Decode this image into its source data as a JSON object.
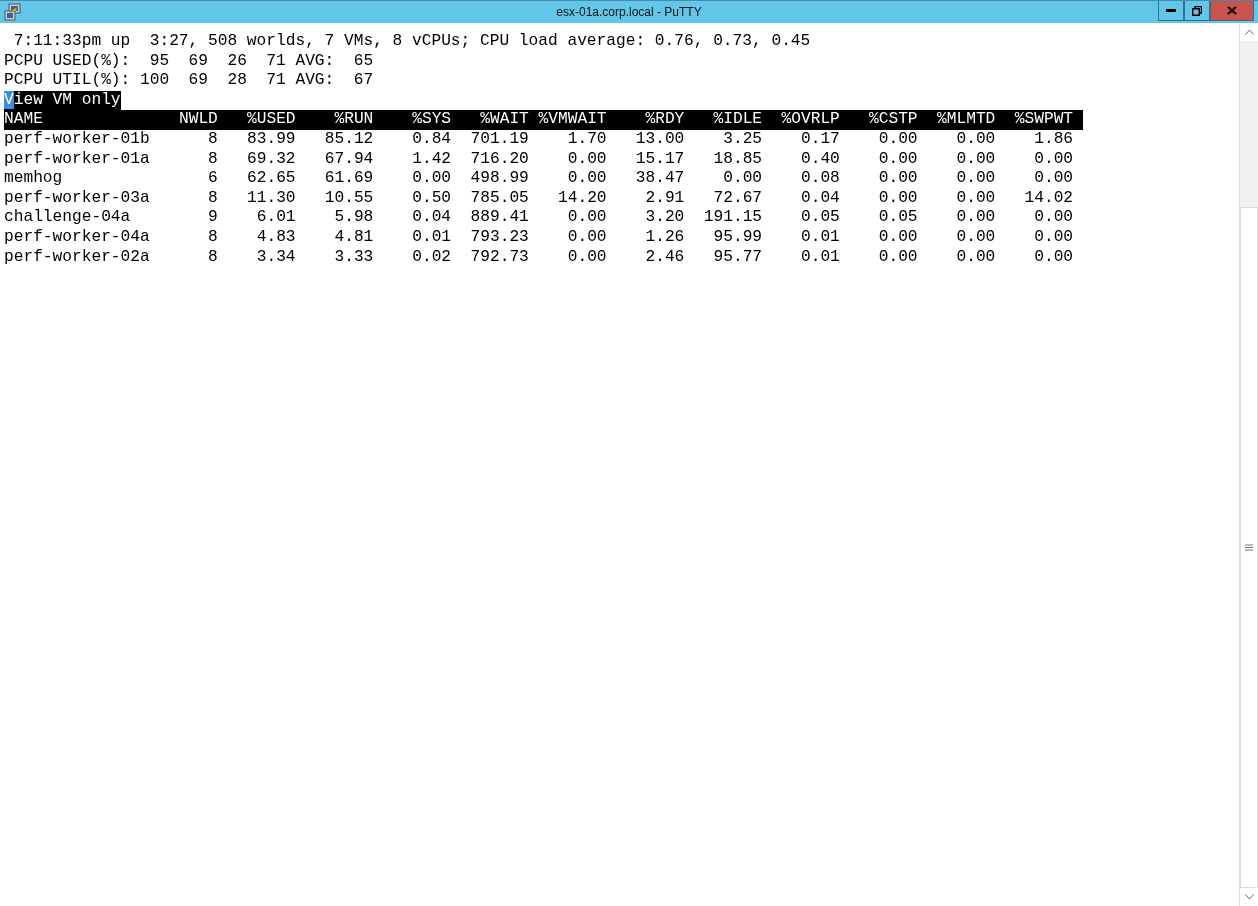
{
  "window": {
    "title": "esx-01a.corp.local - PuTTY"
  },
  "status_lines": [
    " 7:11:33pm up  3:27, 508 worlds, 7 VMs, 8 vCPUs; CPU load average: 0.76, 0.73, 0.45",
    "PCPU USED(%):  95  69  26  71 AVG:  65",
    "PCPU UTIL(%): 100  69  28  71 AVG:  67"
  ],
  "prompt": {
    "text": "View VM only",
    "cursor_at_start": true
  },
  "table": {
    "columns": [
      "NAME",
      "NWLD",
      "%USED",
      "%RUN",
      "%SYS",
      "%WAIT",
      "%VMWAIT",
      "%RDY",
      "%IDLE",
      "%OVRLP",
      "%CSTP",
      "%MLMTD",
      "%SWPWT"
    ],
    "rows": [
      [
        "perf-worker-01b",
        "8",
        "83.99",
        "85.12",
        "0.84",
        "701.19",
        "1.70",
        "13.00",
        "3.25",
        "0.17",
        "0.00",
        "0.00",
        "1.86"
      ],
      [
        "perf-worker-01a",
        "8",
        "69.32",
        "67.94",
        "1.42",
        "716.20",
        "0.00",
        "15.17",
        "18.85",
        "0.40",
        "0.00",
        "0.00",
        "0.00"
      ],
      [
        "memhog",
        "6",
        "62.65",
        "61.69",
        "0.00",
        "498.99",
        "0.00",
        "38.47",
        "0.00",
        "0.08",
        "0.00",
        "0.00",
        "0.00"
      ],
      [
        "perf-worker-03a",
        "8",
        "11.30",
        "10.55",
        "0.50",
        "785.05",
        "14.20",
        "2.91",
        "72.67",
        "0.04",
        "0.00",
        "0.00",
        "14.02"
      ],
      [
        "challenge-04a",
        "9",
        "6.01",
        "5.98",
        "0.04",
        "889.41",
        "0.00",
        "3.20",
        "191.15",
        "0.05",
        "0.05",
        "0.00",
        "0.00"
      ],
      [
        "perf-worker-04a",
        "8",
        "4.83",
        "4.81",
        "0.01",
        "793.23",
        "0.00",
        "1.26",
        "95.99",
        "0.01",
        "0.00",
        "0.00",
        "0.00"
      ],
      [
        "perf-worker-02a",
        "8",
        "3.34",
        "3.33",
        "0.02",
        "792.73",
        "0.00",
        "2.46",
        "95.77",
        "0.01",
        "0.00",
        "0.00",
        "0.00"
      ]
    ]
  }
}
